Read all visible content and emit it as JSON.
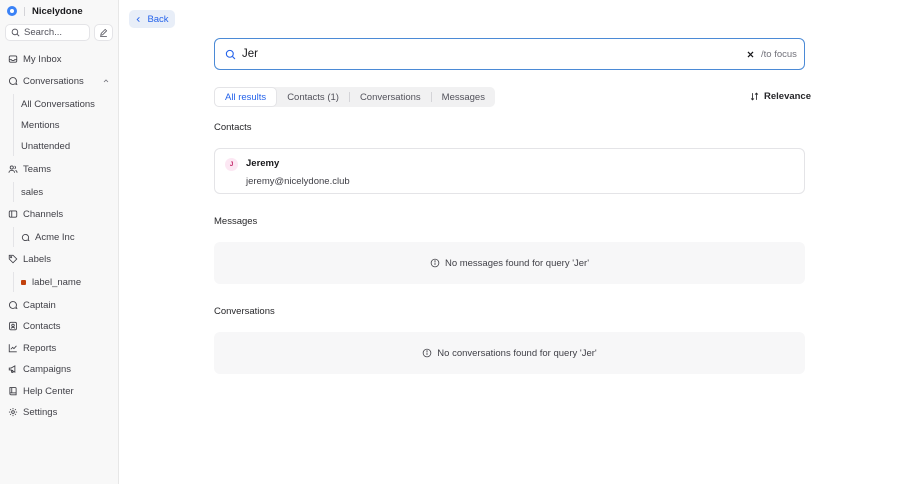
{
  "brand": {
    "name": "Nicelydone"
  },
  "sidebar": {
    "search_placeholder": "Search...",
    "items": [
      {
        "label": "My Inbox"
      },
      {
        "label": "Conversations"
      },
      {
        "label": "Teams"
      },
      {
        "label": "Channels"
      },
      {
        "label": "Labels"
      },
      {
        "label": "Captain"
      },
      {
        "label": "Contacts"
      },
      {
        "label": "Reports"
      },
      {
        "label": "Campaigns"
      },
      {
        "label": "Help Center"
      },
      {
        "label": "Settings"
      }
    ],
    "conversation_subitems": [
      {
        "label": "All Conversations"
      },
      {
        "label": "Mentions"
      },
      {
        "label": "Unattended"
      }
    ],
    "team_subitems": [
      {
        "label": "sales"
      }
    ],
    "channel_subitems": [
      {
        "label": "Acme Inc"
      }
    ],
    "label_subitems": [
      {
        "label": "label_name",
        "color": "#c2410c"
      }
    ]
  },
  "main": {
    "back_label": "Back",
    "search": {
      "query": "Jer",
      "hint": "/to focus"
    },
    "tabs": [
      {
        "label": "All results",
        "active": true
      },
      {
        "label": "Contacts (1)",
        "active": false
      },
      {
        "label": "Conversations",
        "active": false
      },
      {
        "label": "Messages",
        "active": false
      }
    ],
    "sort_label": "Relevance",
    "sections": {
      "contacts_title": "Contacts",
      "messages_title": "Messages",
      "conversations_title": "Conversations"
    },
    "contact": {
      "initial": "J",
      "name": "Jeremy",
      "email": "jeremy@nicelydone.club"
    },
    "messages_empty": "No messages found for query 'Jer'",
    "conversations_empty": "No conversations found for query 'Jer'"
  },
  "colors": {
    "accent": "#2563eb",
    "focus_border": "#4b8ad6",
    "label_dot": "#c2410c"
  }
}
